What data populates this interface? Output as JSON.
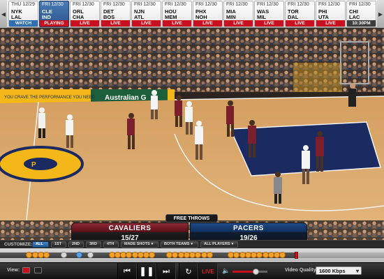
{
  "scorebar": {
    "games": [
      {
        "date": "THU 12/29",
        "team1": "NYK",
        "team2": "LAL",
        "status": "WATCH",
        "kind": "watch",
        "selected": false
      },
      {
        "date": "FRI 12/30",
        "team1": "CLE",
        "team2": "IND",
        "status": "PLAYING",
        "kind": "playing",
        "selected": true
      },
      {
        "date": "FRI 12/30",
        "team1": "ORL",
        "team2": "CHA",
        "status": "LIVE",
        "kind": "live",
        "selected": false
      },
      {
        "date": "FRI 12/30",
        "team1": "DET",
        "team2": "BOS",
        "status": "LIVE",
        "kind": "live",
        "selected": false
      },
      {
        "date": "FRI 12/30",
        "team1": "NJN",
        "team2": "ATL",
        "status": "LIVE",
        "kind": "live",
        "selected": false
      },
      {
        "date": "FRI 12/30",
        "team1": "HOU",
        "team2": "MEM",
        "status": "LIVE",
        "kind": "live",
        "selected": false
      },
      {
        "date": "FRI 12/30",
        "team1": "PHX",
        "team2": "NOH",
        "status": "LIVE",
        "kind": "live",
        "selected": false
      },
      {
        "date": "FRI 12/30",
        "team1": "MIA",
        "team2": "MIN",
        "status": "LIVE",
        "kind": "live",
        "selected": false
      },
      {
        "date": "FRI 12/30",
        "team1": "WAS",
        "team2": "MIL",
        "status": "LIVE",
        "kind": "live",
        "selected": false
      },
      {
        "date": "FRI 12/30",
        "team1": "TOR",
        "team2": "DAL",
        "status": "LIVE",
        "kind": "live",
        "selected": false
      },
      {
        "date": "FRI 12/30",
        "team1": "PHI",
        "team2": "UTA",
        "status": "LIVE",
        "kind": "live",
        "selected": false
      },
      {
        "date": "FRI 12/30",
        "team1": "CHI",
        "team2": "LAC",
        "status": "10:30PM",
        "kind": "time",
        "selected": false
      }
    ]
  },
  "video": {
    "banner_text": "YOU CRAVE THE PERFORMANCE YOU NEED",
    "sponsor_text": "Australian G"
  },
  "scorebox": {
    "title": "FREE THROWS",
    "away_name": "CAVALIERS",
    "away_ft": "15/27",
    "home_name": "PACERS",
    "home_ft": "19/26"
  },
  "customize": {
    "label": "CUSTOMIZE:",
    "buttons": [
      {
        "label": "ALL",
        "active": true,
        "dropdown": false
      },
      {
        "label": "1ST",
        "active": false,
        "dropdown": false
      },
      {
        "label": "2ND",
        "active": false,
        "dropdown": false
      },
      {
        "label": "3RD",
        "active": false,
        "dropdown": false
      },
      {
        "label": "4TH",
        "active": false,
        "dropdown": false
      },
      {
        "label": "MADE SHOTS",
        "active": false,
        "dropdown": true
      },
      {
        "label": "BOTH TEAMS",
        "active": false,
        "dropdown": true
      },
      {
        "label": "ALL PLAYERS",
        "active": false,
        "dropdown": true
      }
    ]
  },
  "timeline": {
    "progress": 0.77,
    "markers": [
      {
        "pos": 0.075,
        "kind": "orange"
      },
      {
        "pos": 0.09,
        "kind": "orange"
      },
      {
        "pos": 0.105,
        "kind": "orange"
      },
      {
        "pos": 0.12,
        "kind": "orange"
      },
      {
        "pos": 0.165,
        "kind": "gray"
      },
      {
        "pos": 0.205,
        "kind": "blue"
      },
      {
        "pos": 0.235,
        "kind": "gray"
      },
      {
        "pos": 0.29,
        "kind": "orange"
      },
      {
        "pos": 0.305,
        "kind": "orange"
      },
      {
        "pos": 0.32,
        "kind": "orange"
      },
      {
        "pos": 0.335,
        "kind": "orange"
      },
      {
        "pos": 0.35,
        "kind": "orange"
      },
      {
        "pos": 0.365,
        "kind": "orange"
      },
      {
        "pos": 0.38,
        "kind": "orange"
      },
      {
        "pos": 0.395,
        "kind": "orange"
      },
      {
        "pos": 0.44,
        "kind": "orange"
      },
      {
        "pos": 0.455,
        "kind": "orange"
      },
      {
        "pos": 0.47,
        "kind": "orange"
      },
      {
        "pos": 0.485,
        "kind": "orange"
      },
      {
        "pos": 0.5,
        "kind": "orange"
      },
      {
        "pos": 0.515,
        "kind": "orange"
      },
      {
        "pos": 0.53,
        "kind": "orange"
      },
      {
        "pos": 0.545,
        "kind": "orange"
      },
      {
        "pos": 0.6,
        "kind": "orange"
      },
      {
        "pos": 0.615,
        "kind": "orange"
      },
      {
        "pos": 0.63,
        "kind": "orange"
      },
      {
        "pos": 0.645,
        "kind": "orange"
      },
      {
        "pos": 0.66,
        "kind": "orange"
      },
      {
        "pos": 0.675,
        "kind": "orange"
      },
      {
        "pos": 0.69,
        "kind": "orange"
      },
      {
        "pos": 0.705,
        "kind": "orange"
      },
      {
        "pos": 0.72,
        "kind": "orange"
      },
      {
        "pos": 0.735,
        "kind": "orange"
      }
    ]
  },
  "controls": {
    "view_label": "View:",
    "live_label": "LIVE",
    "quality_label": "Video Quality:",
    "quality_value": "1600 Kbps",
    "volume": 0.65,
    "icons": {
      "prev": "skip-back-icon",
      "pause": "pause-icon",
      "next": "fast-forward-icon",
      "replay": "replay-icon",
      "volume": "volume-icon"
    }
  },
  "colors": {
    "live_red": "#c8101e",
    "watch_blue": "#2e6fb3",
    "cavaliers_wine": "#7a1f2b",
    "pacers_navy": "#12305f",
    "court_wood": "#d8a86b",
    "pacers_gold": "#f3b717"
  }
}
